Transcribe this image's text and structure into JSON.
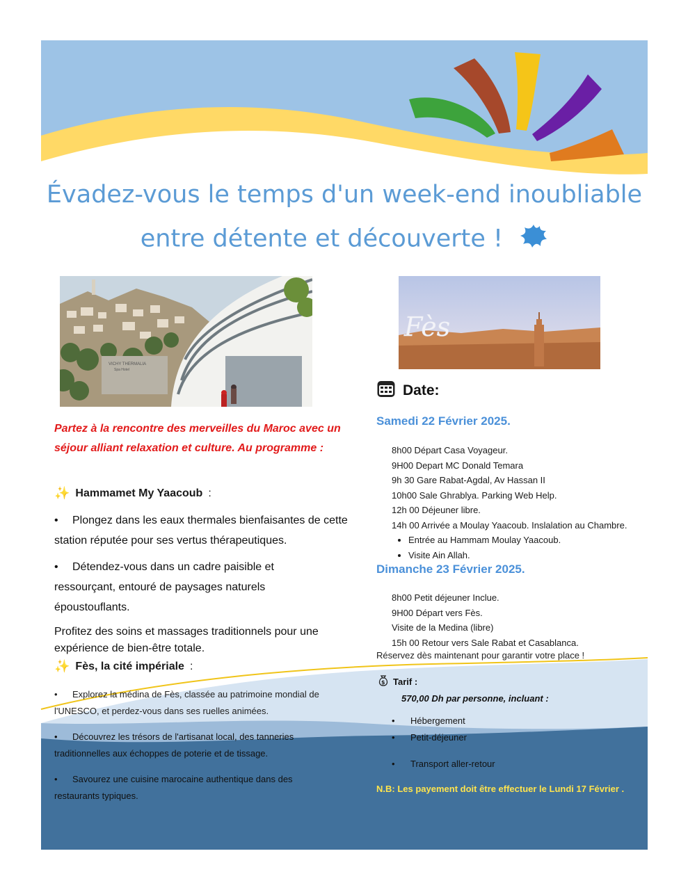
{
  "colors": {
    "sky": "#9dc3e6",
    "sun_yellow": "#ffd966",
    "dark_blue": "#41719c",
    "mid_blue": "#5b8dbf",
    "headline_blue": "#5b9bd5",
    "intro_red": "#e21b1b",
    "note_yellow": "#ffe44d"
  },
  "header": {
    "line1": "Évadez-vous le temps d'un week-end inoubliable",
    "line2": "entre détente et découverte !",
    "splash_icon": "blue-splash-icon"
  },
  "images": {
    "left_photo": "photo-vichy-thermalia-hotel",
    "right_photo": "photo-fes-panorama",
    "fes_script": "Fès",
    "sign_line1": "VICHY THERMALIA",
    "sign_line2": "Spa Hotel"
  },
  "intro": "Partez à la rencontre des merveilles du Maroc avec un séjour alliant relaxation et culture. Au programme :",
  "section1": {
    "icon": "sparkles-icon",
    "title": "Hammamet My Yaacoub",
    "suffix": " :",
    "bullets": [
      "Plongez dans les eaux thermales bienfaisantes de cette station réputée pour ses vertus thérapeutiques.",
      "Détendez-vous dans un cadre paisible et ressourçant, entouré de paysages naturels époustouflants."
    ],
    "closing": "Profitez des soins et massages traditionnels pour une expérience de bien-être totale."
  },
  "section2": {
    "icon": "sparkles-icon",
    "title": "Fès, la cité impériale",
    "suffix": " :",
    "bullets": [
      "Explorez la médina de Fès, classée au patrimoine mondial de l'UNESCO, et perdez-vous dans ses ruelles animées.",
      "Découvrez les trésors de l'artisanat local, des tanneries traditionnelles aux échoppes de poterie et de tissage.",
      "Savourez une cuisine marocaine authentique dans des restaurants typiques."
    ]
  },
  "date": {
    "icon": "calendar-icon",
    "label": "Date:",
    "day1": {
      "title": "Samedi 22 Février 2025.",
      "lines": [
        "8h00 Départ Casa Voyageur.",
        "9H00 Depart MC Donald Temara",
        "9h 30 Gare Rabat-Agdal, Av  Hassan II",
        "10h00 Sale Ghrablya. Parking Web Help.",
        "12h 00 Déjeuner libre.",
        "14h 00 Arrivée a Moulay Yaacoub. Inslalation au Chambre."
      ],
      "bullets": [
        "Entrée au Hammam Moulay Yaacoub.",
        "Visite Ain Allah."
      ]
    },
    "day2": {
      "title": "Dimanche 23 Février 2025.",
      "lines": [
        "8h00 Petit déjeuner Inclue.",
        "9H00 Départ vers Fès.",
        "Visite de la Medina (libre)",
        "15h 00 Retour vers Sale Rabat et Casablanca."
      ]
    },
    "reserve": "Réservez dès maintenant pour garantir votre place !"
  },
  "tarif": {
    "icon": "money-bag-icon",
    "label": "Tarif :",
    "price": "570,00 Dh par personne, incluant :",
    "items": [
      "Hébergement",
      "Petit-déjeuner",
      "Transport aller-retour"
    ]
  },
  "note": "N.B: Les payement doit être effectuer le Lundi 17 Février ."
}
